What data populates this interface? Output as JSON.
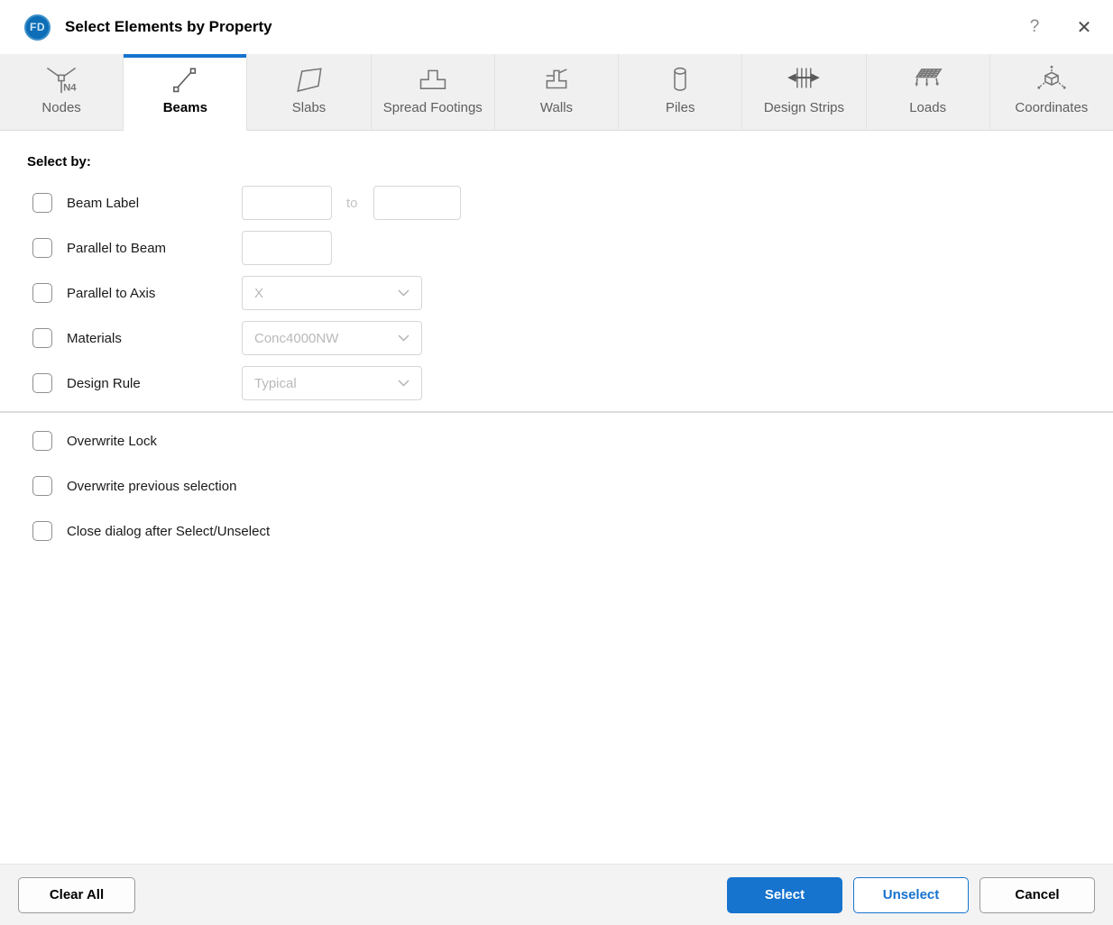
{
  "titlebar": {
    "logo_text": "FD",
    "title": "Select Elements by Property",
    "help_label": "?",
    "close_label": "✕"
  },
  "tabs": {
    "active": "Beams",
    "items": [
      {
        "label": "Nodes",
        "icon": "nodes-icon",
        "node_tag": "N4"
      },
      {
        "label": "Beams",
        "icon": "beams-icon"
      },
      {
        "label": "Slabs",
        "icon": "slabs-icon"
      },
      {
        "label": "Spread Footings",
        "icon": "spread-footings-icon"
      },
      {
        "label": "Walls",
        "icon": "walls-icon"
      },
      {
        "label": "Piles",
        "icon": "piles-icon"
      },
      {
        "label": "Design Strips",
        "icon": "design-strips-icon"
      },
      {
        "label": "Loads",
        "icon": "loads-icon"
      },
      {
        "label": "Coordinates",
        "icon": "coordinates-icon"
      }
    ]
  },
  "form": {
    "heading": "Select by:",
    "rows": [
      {
        "label": "Beam Label",
        "checked": false,
        "control": "range",
        "from_value": "",
        "to_value": "",
        "separator": "to"
      },
      {
        "label": "Parallel to Beam",
        "checked": false,
        "control": "input",
        "value": ""
      },
      {
        "label": "Parallel to Axis",
        "checked": false,
        "control": "dropdown",
        "value": "X"
      },
      {
        "label": "Materials",
        "checked": false,
        "control": "dropdown",
        "value": "Conc4000NW"
      },
      {
        "label": "Design Rule",
        "checked": false,
        "control": "dropdown",
        "value": "Typical"
      }
    ],
    "options": [
      {
        "label": "Overwrite Lock",
        "checked": false
      },
      {
        "label": "Overwrite previous selection",
        "checked": false
      },
      {
        "label": "Close dialog after Select/Unselect",
        "checked": false
      }
    ]
  },
  "footer": {
    "clear_all_label": "Clear All",
    "select_label": "Select",
    "unselect_label": "Unselect",
    "cancel_label": "Cancel"
  },
  "colors": {
    "accent_blue": "#1673ce",
    "logo_blue": "#0d6db6",
    "tab_inactive_bg": "#f0f0f0",
    "footer_bg": "#f3f3f3",
    "input_border": "#d6d6d6",
    "placeholder_gray": "#b9b9b9"
  }
}
